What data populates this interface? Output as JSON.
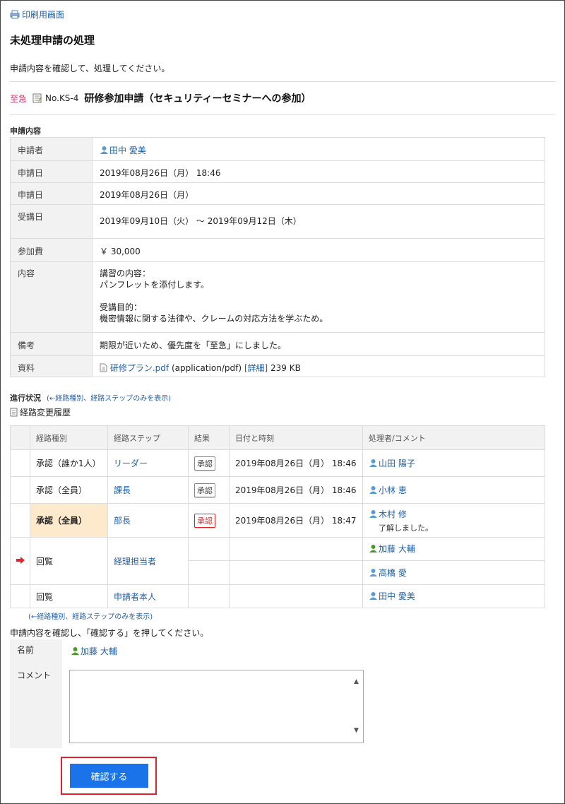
{
  "header": {
    "print_label": "印刷用画面",
    "page_title": "未処理申請の処理",
    "instruction": "申請内容を確認して、処理してください。"
  },
  "request": {
    "priority": "至急",
    "number": "No.KS-4",
    "title": "研修参加申請（セキュリティーセミナーへの参加）"
  },
  "details": {
    "section_label": "申請内容",
    "rows": [
      {
        "label": "申請者",
        "value": "田中 愛美"
      },
      {
        "label": "申請日",
        "value": "2019年08月26日（月） 18:46"
      },
      {
        "label": "申請日",
        "value": "2019年08月26日（月）"
      },
      {
        "label": "受講日",
        "value": "2019年09月10日（火） ～ 2019年09月12日（木）"
      },
      {
        "label": "参加費",
        "value": "￥ 30,000"
      },
      {
        "label": "内容",
        "value_lines": [
          "講習の内容：",
          "パンフレットを添付します。",
          "",
          "受講目的：",
          "機密情報に関する法律や、クレームの対応方法を学ぶため。"
        ]
      },
      {
        "label": "備考",
        "value": "期限が近いため、優先度を「至急」にしました。"
      },
      {
        "label": "資料",
        "file": "研修プラン.pdf",
        "mime": "(application/pdf)",
        "detail_link": "[詳細]",
        "size": "239 KB"
      }
    ]
  },
  "progress": {
    "label": "進行状況",
    "toggle_link": "(←経路種別、経路ステップのみを表示)",
    "toggle_link_bottom": "(←経路種別、経路ステップのみを表示)",
    "history_label": "経路変更履歴",
    "columns": [
      "経路種別",
      "経路ステップ",
      "結果",
      "日付と時刻",
      "処理者/コメント"
    ],
    "rows": [
      {
        "type": "承認（誰か1人）",
        "step": "リーダー",
        "result": "承認",
        "datetime": "2019年08月26日（月） 18:46",
        "user": "山田 陽子"
      },
      {
        "type": "承認（全員）",
        "step": "課長",
        "result": "承認",
        "datetime": "2019年08月26日（月） 18:46",
        "user": "小林 恵"
      },
      {
        "type": "承認（全員）",
        "step": "部長",
        "result": "承認",
        "datetime": "2019年08月26日（月） 18:47",
        "user": "木村 修",
        "comment": "了解しました。"
      },
      {
        "type": "回覧",
        "step": "経理担当者",
        "users": [
          "加藤 大輔",
          "高橋 愛"
        ]
      },
      {
        "type": "回覧",
        "step": "申請者本人",
        "user": "田中 愛美"
      }
    ]
  },
  "form": {
    "instruction": "申請内容を確認し、「確認する」を押してください。",
    "name_label": "名前",
    "name_value": "加藤 大輔",
    "comment_label": "コメント",
    "comment_value": "",
    "submit_label": "確認する"
  },
  "colors": {
    "link": "#1f5fa8",
    "urgent": "#d2366b",
    "button": "#1a73e8",
    "highlight_row": "#fde9cc",
    "focus_border": "#e0202a"
  }
}
